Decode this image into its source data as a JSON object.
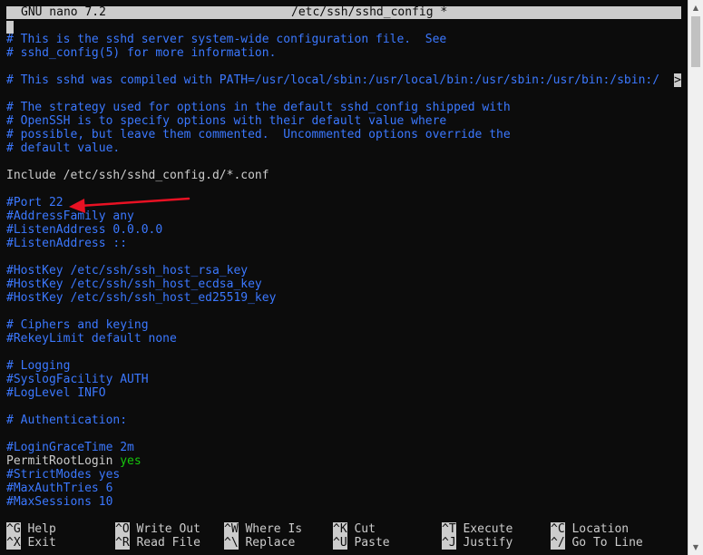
{
  "title_bar": {
    "app": "GNU nano 7.2",
    "file": "/etc/ssh/sshd_config *"
  },
  "editor_lines": [
    "# This is the sshd server system-wide configuration file.  See",
    "# sshd_config(5) for more information.",
    "",
    "# This sshd was compiled with PATH=/usr/local/sbin:/usr/local/bin:/usr/sbin:/usr/bin:/sbin:/",
    "",
    "# The strategy used for options in the default sshd_config shipped with",
    "# OpenSSH is to specify options with their default value where",
    "# possible, but leave them commented.  Uncommented options override the",
    "# default value.",
    "",
    "Include /etc/ssh/sshd_config.d/*.conf",
    "",
    "#Port 22",
    "#AddressFamily any",
    "#ListenAddress 0.0.0.0",
    "#ListenAddress ::",
    "",
    "#HostKey /etc/ssh/ssh_host_rsa_key",
    "#HostKey /etc/ssh/ssh_host_ecdsa_key",
    "#HostKey /etc/ssh/ssh_host_ed25519_key",
    "",
    "# Ciphers and keying",
    "#RekeyLimit default none",
    "",
    "# Logging",
    "#SyslogFacility AUTH",
    "#LogLevel INFO",
    "",
    "# Authentication:",
    "",
    "#LoginGraceTime 2m",
    "PermitRootLogin yes",
    "#StrictModes yes",
    "#MaxAuthTries 6",
    "#MaxSessions 10"
  ],
  "line_overflow_marker": ">",
  "shortcuts": [
    {
      "key": "^G",
      "label": "Help"
    },
    {
      "key": "^O",
      "label": "Write Out"
    },
    {
      "key": "^W",
      "label": "Where Is"
    },
    {
      "key": "^K",
      "label": "Cut"
    },
    {
      "key": "^T",
      "label": "Execute"
    },
    {
      "key": "^C",
      "label": "Location"
    },
    {
      "key": "^X",
      "label": "Exit"
    },
    {
      "key": "^R",
      "label": "Read File"
    },
    {
      "key": "^\\",
      "label": "Replace"
    },
    {
      "key": "^U",
      "label": "Paste"
    },
    {
      "key": "^J",
      "label": "Justify"
    },
    {
      "key": "^/",
      "label": "Go To Line"
    }
  ],
  "colors": {
    "background": "#0c0c0c",
    "foreground": "#cccccc",
    "comment": "#3b78ff",
    "value_yes": "#16c60c",
    "annotation_arrow": "#e81123"
  },
  "annotation": {
    "icon": "red-arrow-icon",
    "points_to": "#Port 22"
  }
}
